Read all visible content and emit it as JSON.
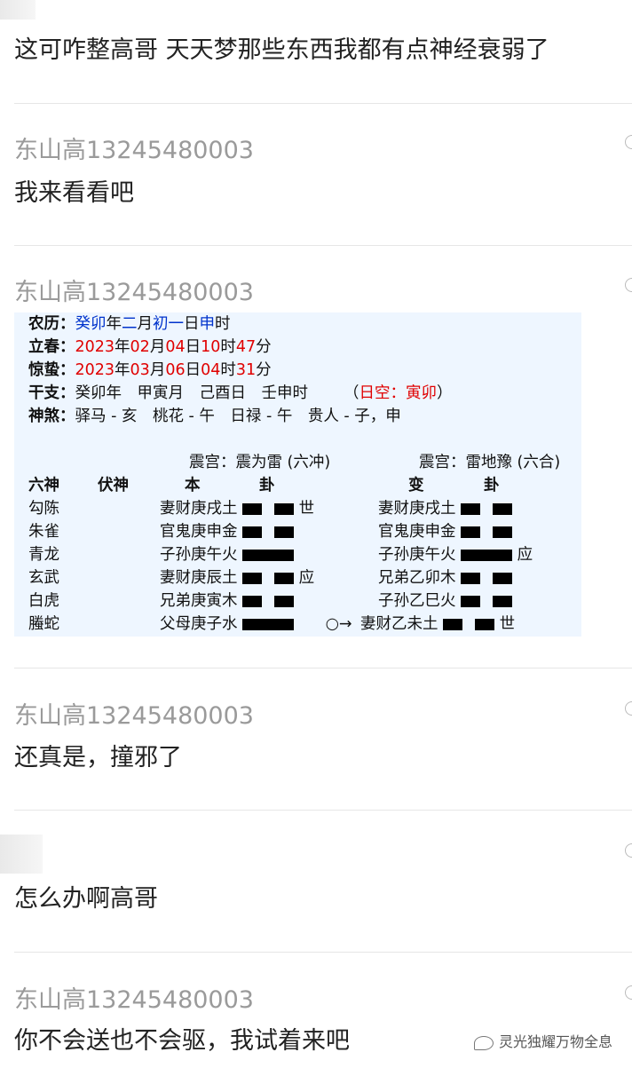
{
  "messages": [
    {
      "name": "",
      "text": "这可咋整高哥 天天梦那些东西我都有点神经衰弱了"
    },
    {
      "name": "东山高13245480003",
      "text": "我来看看吧"
    },
    {
      "name": "东山高13245480003",
      "text": ""
    },
    {
      "name": "东山高13245480003",
      "text": "还真是，撞邪了"
    },
    {
      "name": "",
      "text": "怎么办啊高哥"
    },
    {
      "name": "东山高13245480003",
      "text": "你不会送也不会驱，我试着来吧"
    }
  ],
  "divination": {
    "nongli_label": "农历：",
    "nongli": [
      "癸卯",
      "年",
      "二",
      "月",
      "初一",
      "日",
      "申",
      "时"
    ],
    "lichun_label": "立春：",
    "lichun": [
      "2023",
      "年",
      "02",
      "月",
      "04",
      "日",
      "10",
      "时",
      "47",
      "分"
    ],
    "jingzhe_label": "惊蛰：",
    "jingzhe": [
      "2023",
      "年",
      "03",
      "月",
      "06",
      "日",
      "04",
      "时",
      "31",
      "分"
    ],
    "ganzhi_label": "干支：",
    "ganzhi": "癸卯年　甲寅月　己酉日　壬申时",
    "kong_open": "（",
    "kong": "日空：寅卯",
    "kong_close": "）",
    "shensha_label": "神煞：",
    "shensha": "驿马 - 亥　桃花 - 午　日禄 - 午　贵人 - 子，申",
    "ben_palace": "震宫：震为雷 (六冲)",
    "bian_palace": "震宫：雷地豫 (六合)",
    "headers": {
      "liushen": "六神",
      "fushen": "伏神",
      "ben": "本",
      "gua1": "卦",
      "bian": "变",
      "gua2": "卦"
    },
    "rows": [
      {
        "god": "勾陈",
        "ben": "妻财庚戌土",
        "ben_line": "yin",
        "mark": "世",
        "bian": "妻财庚戌土",
        "bian_line": "yin",
        "bmark": ""
      },
      {
        "god": "朱雀",
        "ben": "官鬼庚申金",
        "ben_line": "yin",
        "mark": "",
        "bian": "官鬼庚申金",
        "bian_line": "yin",
        "bmark": ""
      },
      {
        "god": "青龙",
        "ben": "子孙庚午火",
        "ben_line": "yang",
        "mark": "",
        "bian": "子孙庚午火",
        "bian_line": "yang",
        "bmark": "应"
      },
      {
        "god": "玄武",
        "ben": "妻财庚辰土",
        "ben_line": "yin",
        "mark": "应",
        "bian": "兄弟乙卯木",
        "bian_line": "yin",
        "bmark": ""
      },
      {
        "god": "白虎",
        "ben": "兄弟庚寅木",
        "ben_line": "yin",
        "mark": "",
        "bian": "子孙乙巳火",
        "bian_line": "yin",
        "bmark": ""
      },
      {
        "god": "螣蛇",
        "ben": "父母庚子水",
        "ben_line": "yang",
        "mark": "○→",
        "bian": "妻财乙未土",
        "bian_line": "yin",
        "bmark": "世"
      }
    ]
  },
  "footer": {
    "label": "灵光独耀万物全息"
  }
}
